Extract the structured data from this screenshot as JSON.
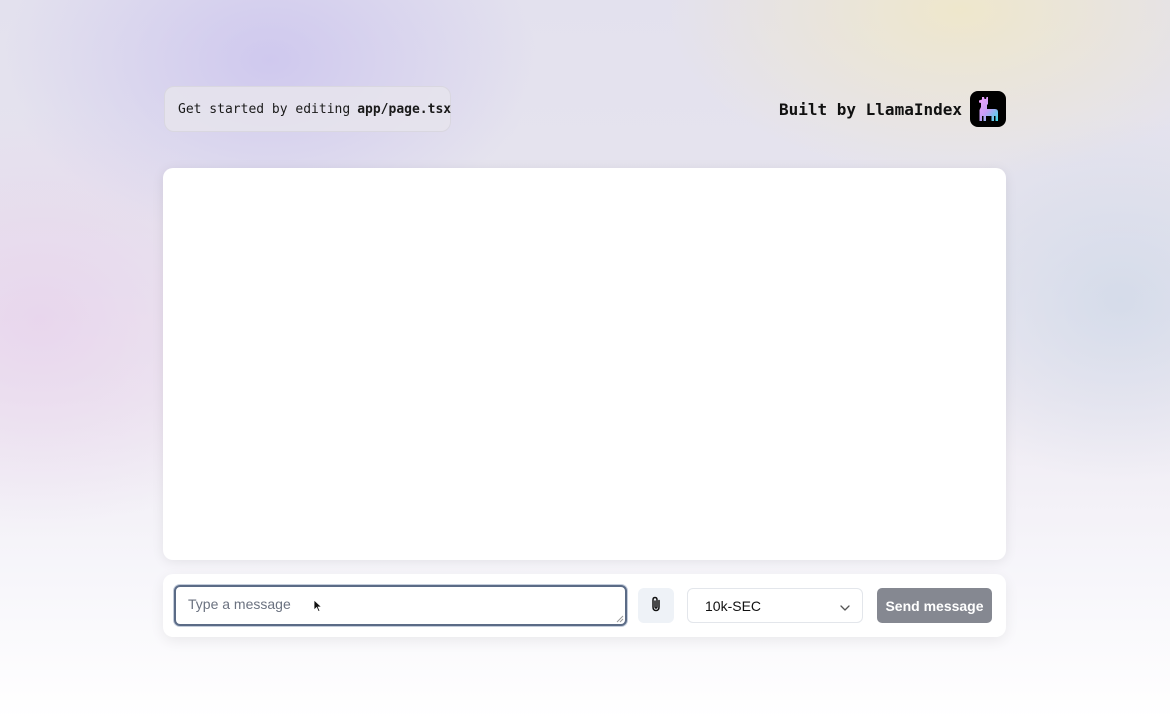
{
  "header": {
    "hint_prefix": "Get started by editing",
    "hint_code": "app/page.tsx",
    "brand_text": "Built by LlamaIndex",
    "brand_logo_icon": "llama-icon"
  },
  "chat": {
    "messages": []
  },
  "input_bar": {
    "message_placeholder": "Type a message",
    "message_value": "",
    "attach_icon": "paperclip-icon",
    "model_selected": "10k-SEC",
    "model_chevron_icon": "chevron-down-icon",
    "send_label": "Send message"
  },
  "colors": {
    "send_button_bg": "#858891",
    "input_border_focus": "#5b6b86",
    "attach_button_bg": "#eef2f7"
  }
}
